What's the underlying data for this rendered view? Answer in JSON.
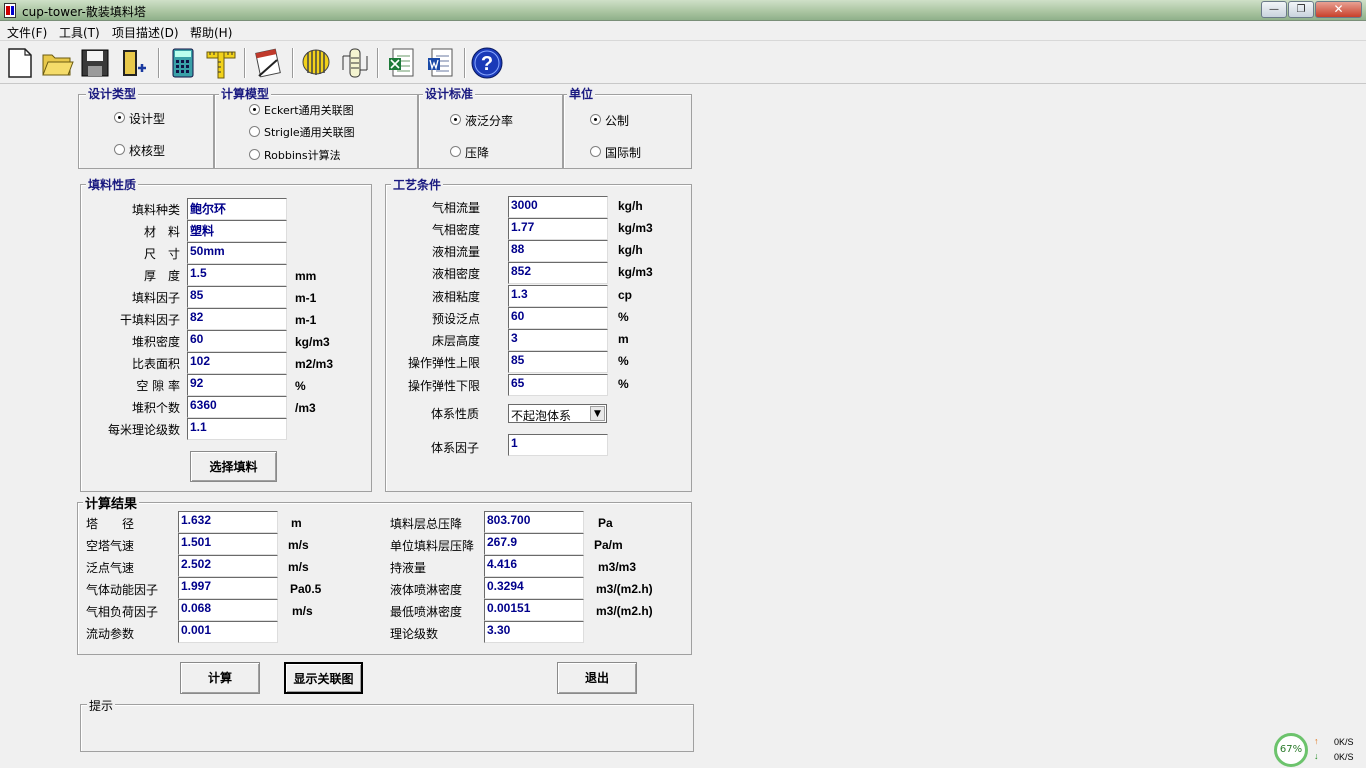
{
  "window": {
    "title": "cup-tower-散装填料塔",
    "min": "0",
    "max": "1",
    "close": "r"
  },
  "menu": [
    "文件(F)",
    "工具(T)",
    "项目描述(D)",
    "帮助(H)"
  ],
  "toolbar_icons": [
    "new-file-icon",
    "open-folder-icon",
    "save-disk-icon",
    "exit-door-icon",
    "calculator-icon",
    "ruler-icon",
    "notepad-icon",
    "pump-icon",
    "column-icon",
    "excel-icon",
    "word-icon",
    "help-icon"
  ],
  "design_type": {
    "title": "设计类型",
    "options": [
      "设计型",
      "校核型"
    ],
    "selected": 0
  },
  "calc_model": {
    "title": "计算模型",
    "options": [
      "Eckert通用关联图",
      "Strigle通用关联图",
      "Robbins计算法"
    ],
    "selected": 0
  },
  "design_std": {
    "title": "设计标准",
    "options": [
      "液泛分率",
      "压降"
    ],
    "selected": 0
  },
  "unit_sys": {
    "title": "单位",
    "options": [
      "公制",
      "国际制"
    ],
    "selected": 0
  },
  "packing": {
    "title": "填料性质",
    "rows": [
      {
        "label": "填料种类",
        "value": "鲍尔环",
        "unit": ""
      },
      {
        "label": "材　料",
        "value": "塑料",
        "unit": ""
      },
      {
        "label": "尺　寸",
        "value": "50mm",
        "unit": ""
      },
      {
        "label": "厚　度",
        "value": "1.5",
        "unit": "mm"
      },
      {
        "label": "填料因子",
        "value": "85",
        "unit": "m-1"
      },
      {
        "label": "干填料因子",
        "value": "82",
        "unit": "m-1"
      },
      {
        "label": "堆积密度",
        "value": "60",
        "unit": "kg/m3"
      },
      {
        "label": "比表面积",
        "value": "102",
        "unit": "m2/m3"
      },
      {
        "label": "空 隙 率",
        "value": "92",
        "unit": "%"
      },
      {
        "label": "堆积个数",
        "value": "6360",
        "unit": "/m3"
      },
      {
        "label": "每米理论级数",
        "value": "1.1",
        "unit": ""
      }
    ],
    "button": "选择填料"
  },
  "process": {
    "title": "工艺条件",
    "rows": [
      {
        "label": "气相流量",
        "value": "3000",
        "unit": "kg/h"
      },
      {
        "label": "气相密度",
        "value": "1.77",
        "unit": "kg/m3"
      },
      {
        "label": "液相流量",
        "value": "88",
        "unit": "kg/h"
      },
      {
        "label": "液相密度",
        "value": "852",
        "unit": "kg/m3"
      },
      {
        "label": "液相粘度",
        "value": "1.3",
        "unit": "cp"
      },
      {
        "label": "预设泛点",
        "value": "60",
        "unit": "%"
      },
      {
        "label": "床层高度",
        "value": "3",
        "unit": "m"
      },
      {
        "label": "操作弹性上限",
        "value": "85",
        "unit": "%"
      },
      {
        "label": "操作弹性下限",
        "value": "65",
        "unit": "%"
      }
    ],
    "system_label": "体系性质",
    "system_value": "不起泡体系",
    "factor_label": "体系因子",
    "factor_value": "1"
  },
  "results": {
    "title": "计算结果",
    "left": [
      {
        "label": "塔　　径",
        "value": "1.632",
        "unit": "m"
      },
      {
        "label": "空塔气速",
        "value": "1.501",
        "unit": "m/s"
      },
      {
        "label": "泛点气速",
        "value": "2.502",
        "unit": "m/s"
      },
      {
        "label": "气体动能因子",
        "value": "1.997",
        "unit": "Pa0.5"
      },
      {
        "label": "气相负荷因子",
        "value": "0.068",
        "unit": "m/s"
      },
      {
        "label": "流动参数",
        "value": "0.001",
        "unit": ""
      }
    ],
    "right": [
      {
        "label": "填料层总压降",
        "value": "803.700",
        "unit": "Pa"
      },
      {
        "label": "单位填料层压降",
        "value": "267.9",
        "unit": "Pa/m"
      },
      {
        "label": "持液量",
        "value": "4.416",
        "unit": "m3/m3"
      },
      {
        "label": "液体喷淋密度",
        "value": "0.3294",
        "unit": "m3/(m2.h)"
      },
      {
        "label": "最低喷淋密度",
        "value": "0.00151",
        "unit": "m3/(m2.h)"
      },
      {
        "label": "理论级数",
        "value": "3.30",
        "unit": ""
      }
    ]
  },
  "buttons": {
    "calc": "计算",
    "show_chart": "显示关联图",
    "exit": "退出"
  },
  "hint": {
    "title": "提示",
    "text": ""
  },
  "tray": {
    "percent": "67%",
    "up": "0K/S",
    "down": "0K/S"
  }
}
